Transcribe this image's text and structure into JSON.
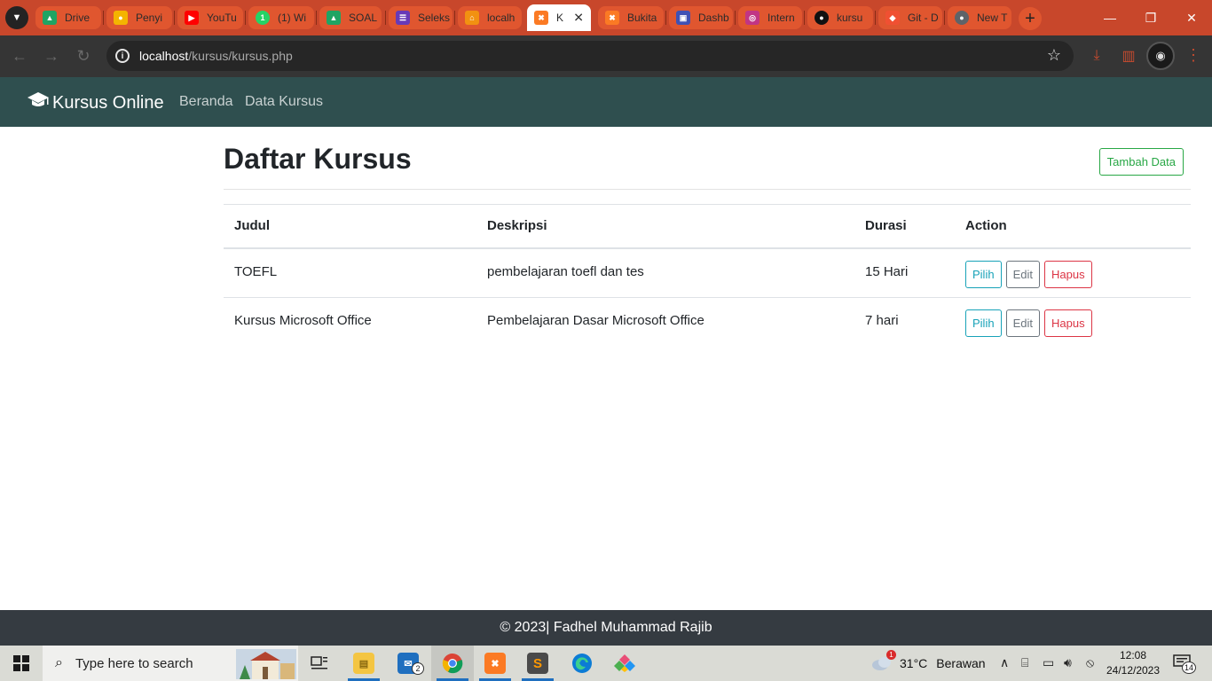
{
  "browser": {
    "tabs": [
      {
        "label": "Drive",
        "color": "#1fa463"
      },
      {
        "label": "Penyi",
        "color": "#f4b400"
      },
      {
        "label": "YouTu",
        "color": "#ff0000"
      },
      {
        "label": "(1) Wi",
        "color": "#25d366"
      },
      {
        "label": "SOAL",
        "color": "#1fa463"
      },
      {
        "label": "Seleks",
        "color": "#673ab7"
      },
      {
        "label": "localh",
        "color": "#f29111"
      },
      {
        "label": "K",
        "color": "#fb7a24"
      },
      {
        "label": "Bukita",
        "color": "#fb7a24"
      },
      {
        "label": "Dashb",
        "color": "#3f51b5"
      },
      {
        "label": "Intern",
        "color": "#c13584"
      },
      {
        "label": "kursu",
        "color": "#111111"
      },
      {
        "label": "Git - D",
        "color": "#f05032"
      },
      {
        "label": "New T",
        "color": "#5f6368"
      }
    ],
    "url_host": "localhost",
    "url_path": "/kursus/kursus.php"
  },
  "navbar": {
    "brand": "Kursus Online",
    "links": [
      "Beranda",
      "Data Kursus"
    ]
  },
  "main": {
    "title": "Daftar Kursus",
    "add_button": "Tambah Data",
    "table": {
      "headers": [
        "Judul",
        "Deskripsi",
        "Durasi",
        "Action"
      ],
      "rows": [
        {
          "judul": "TOEFL",
          "deskripsi": "pembelajaran toefl dan tes",
          "durasi": "15 Hari"
        },
        {
          "judul": "Kursus Microsoft Office",
          "deskripsi": "Pembelajaran Dasar Microsoft Office",
          "durasi": "7 hari"
        }
      ],
      "action_labels": {
        "pilih": "Pilih",
        "edit": "Edit",
        "hapus": "Hapus"
      }
    }
  },
  "footer": {
    "text": "© 2023| Fadhel Muhammad Rajib"
  },
  "taskbar": {
    "search_placeholder": "Type here to search",
    "mail_badge": "2",
    "weather_badge": "1",
    "temperature": "31°C",
    "weather": "Berawan",
    "time": "12:08",
    "date": "24/12/2023",
    "notification_count": "14"
  },
  "colors": {
    "navbar": "#2f4f4f",
    "footer": "#353b41",
    "tabstrip": "#c8472b",
    "success": "#28a745",
    "info": "#17a2b8",
    "secondary": "#6c757d",
    "danger": "#dc3545"
  }
}
